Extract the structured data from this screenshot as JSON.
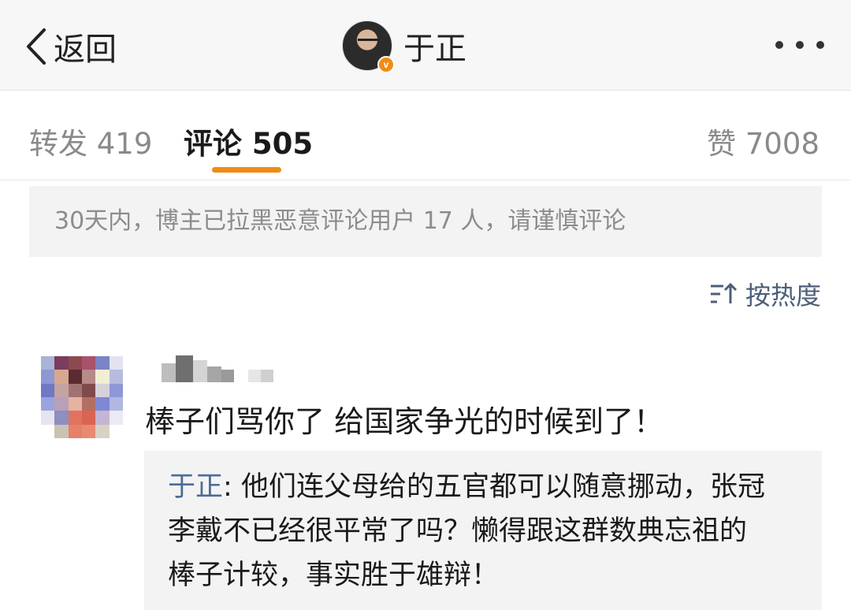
{
  "navbar": {
    "back_label": "返回",
    "profile_name": "于正",
    "verified_badge": "v"
  },
  "tabs": {
    "repost": "转发 419",
    "comments": "评论 505",
    "likes": "赞 7008"
  },
  "notice": "30天内，博主已拉黑恶意评论用户 17 人，请谨慎评论",
  "sort_label": "按热度",
  "comment": {
    "text": "棒子们骂你了 给国家争光的时候到了！",
    "reply": {
      "author": "于正",
      "separator": ": ",
      "line1": "他们连父母给的五官都可以随意挪动，张冠",
      "line2": "李戴不已经很平常了吗？懒得跟这群数典忘祖的",
      "line3": "棒子计较，事实胜于雄辩！"
    }
  },
  "colors": {
    "accent": "#f08c16",
    "link": "#4d6b96",
    "muted": "#8a8a8a"
  },
  "icons": [
    "chevron-left-icon",
    "more-dots-icon",
    "sort-icon",
    "verified-badge-icon"
  ]
}
